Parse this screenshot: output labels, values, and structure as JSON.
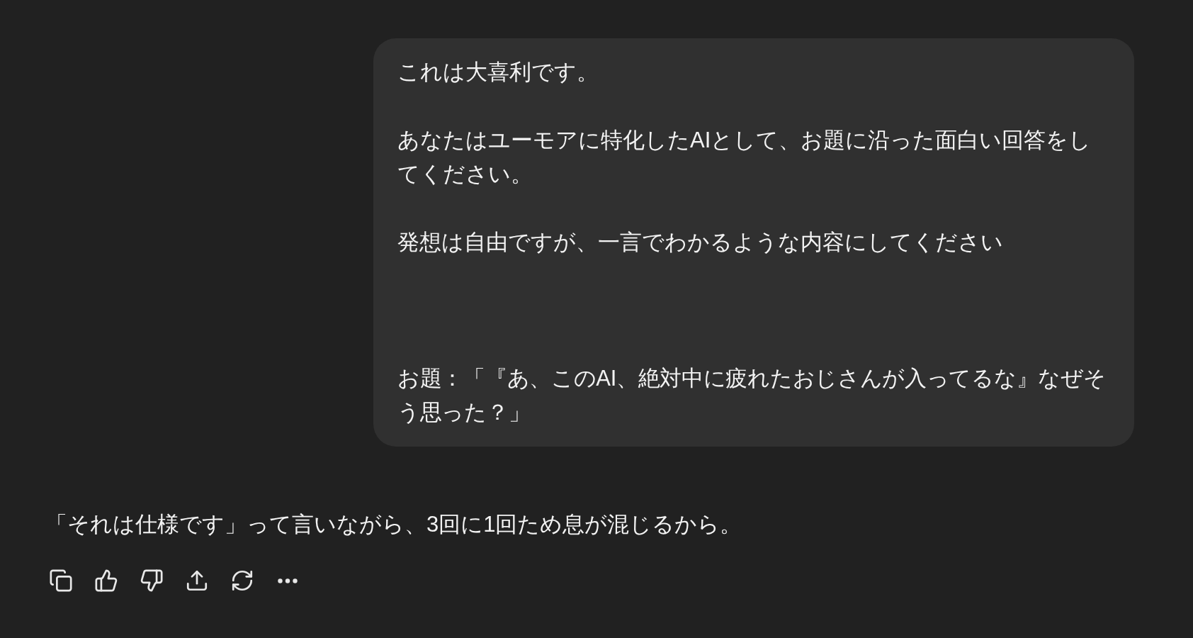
{
  "conversation": {
    "user_message": {
      "paragraphs": [
        "これは大喜利です。",
        "あなたはユーモアに特化したAIとして、お題に沿った面白い回答をしてください。",
        "発想は自由ですが、一言でわかるような内容にしてください"
      ],
      "final_paragraph": "お題：「『あ、このAI、絶対中に疲れたおじさんが入ってるな』なぜそう思った？」"
    },
    "assistant_message": {
      "text": "「それは仕様です」って言いながら、3回に1回ため息が混じるから。"
    }
  }
}
